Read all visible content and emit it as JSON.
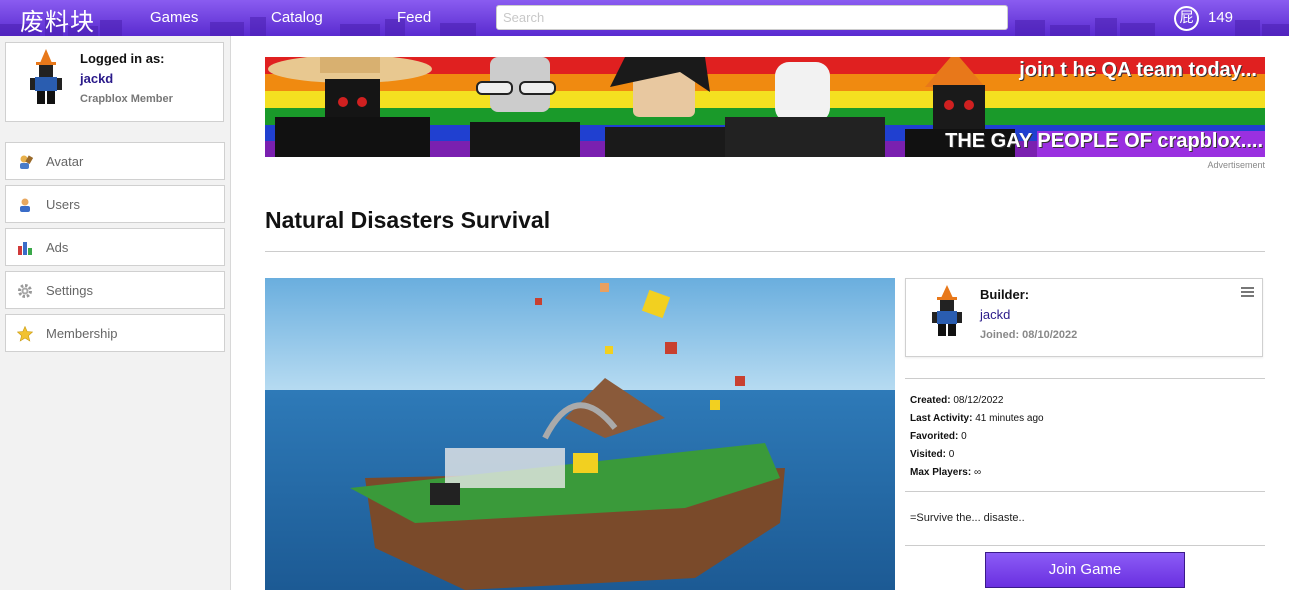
{
  "header": {
    "logo": "废料块",
    "nav": [
      {
        "label": "Games"
      },
      {
        "label": "Catalog"
      },
      {
        "label": "Feed"
      }
    ],
    "search_placeholder": "Search",
    "currency_icon": "屁",
    "currency_amount": "149"
  },
  "sidebar": {
    "logged_in_label": "Logged in as:",
    "username": "jackd",
    "role": "Crapblox Member",
    "items": [
      {
        "label": "Avatar",
        "icon": "avatar-icon"
      },
      {
        "label": "Users",
        "icon": "user-icon"
      },
      {
        "label": "Ads",
        "icon": "bar-chart-icon"
      },
      {
        "label": "Settings",
        "icon": "gear-icon"
      },
      {
        "label": "Membership",
        "icon": "star-icon"
      }
    ]
  },
  "ad": {
    "line1": "join t he QA team today...",
    "line2_part1": "THE GAY",
    "line2_part2": "PEOPLE OF crapblox....",
    "label": "Advertisement"
  },
  "game": {
    "title": "Natural Disasters Survival",
    "builder_label": "Builder:",
    "builder_name": "jackd",
    "joined": "Joined: 08/10/2022",
    "stats": [
      {
        "label": "Created:",
        "value": "08/12/2022"
      },
      {
        "label": "Last Activity:",
        "value": "41 minutes ago"
      },
      {
        "label": "Favorited:",
        "value": "0"
      },
      {
        "label": "Visited:",
        "value": "0"
      },
      {
        "label": "Max Players:",
        "value": "∞"
      }
    ],
    "description": "=Survive the... disaste..",
    "join_label": "Join Game"
  },
  "colors": {
    "accent": "#6a2fe0",
    "link": "#2a1a8a"
  }
}
